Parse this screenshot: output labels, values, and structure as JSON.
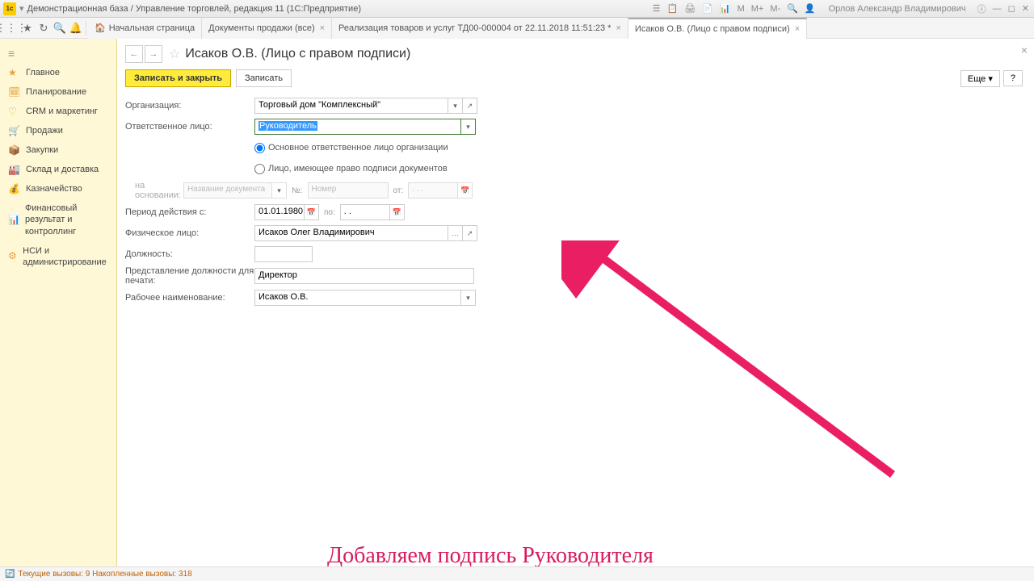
{
  "titlebar": {
    "title": "Демонстрационная база / Управление торговлей, редакция 11  (1С:Предприятие)",
    "user": "Орлов Александр Владимирович"
  },
  "iconbar": {
    "home_tab": "Начальная страница",
    "tabs": [
      "Документы продажи (все)",
      "Реализация товаров и услуг ТД00-000004 от 22.11.2018 11:51:23 *",
      "Исаков О.В. (Лицо с правом подписи)"
    ]
  },
  "sidebar": {
    "items": [
      {
        "label": "Главное"
      },
      {
        "label": "Планирование"
      },
      {
        "label": "CRM и маркетинг"
      },
      {
        "label": "Продажи"
      },
      {
        "label": "Закупки"
      },
      {
        "label": "Склад и доставка"
      },
      {
        "label": "Казначейство"
      },
      {
        "label": "Финансовый результат и контроллинг"
      },
      {
        "label": "НСИ и администрирование"
      }
    ]
  },
  "page": {
    "title": "Исаков О.В. (Лицо с правом подписи)"
  },
  "buttons": {
    "save_close": "Записать и закрыть",
    "save": "Записать",
    "more": "Еще",
    "help": "?"
  },
  "form": {
    "org_label": "Организация:",
    "org_value": "Торговый дом \"Комплексный\"",
    "resp_label": "Ответственное лицо:",
    "resp_value": "Руководитель",
    "radio1": "Основное ответственное лицо организации",
    "radio2": "Лицо, имеющее право подписи документов",
    "basis_label": "на основании:",
    "basis_placeholder": "Название документа",
    "num_label": "№:",
    "num_placeholder": "Номер",
    "from_label": "от:",
    "period_label": "Период действия с:",
    "period_from": "01.01.1980",
    "period_to_label": "по:",
    "phys_label": "Физическое лицо:",
    "phys_value": "Исаков Олег Владимирович",
    "position_label": "Должность:",
    "print_label": "Представление должности для печати:",
    "print_value": "Директор",
    "workname_label": "Рабочее наименование:",
    "workname_value": "Исаков О.В."
  },
  "annotation": "Добавляем подпись Руководителя",
  "statusbar": {
    "text": "Текущие вызовы: 9   Накопленные вызовы: 318"
  }
}
